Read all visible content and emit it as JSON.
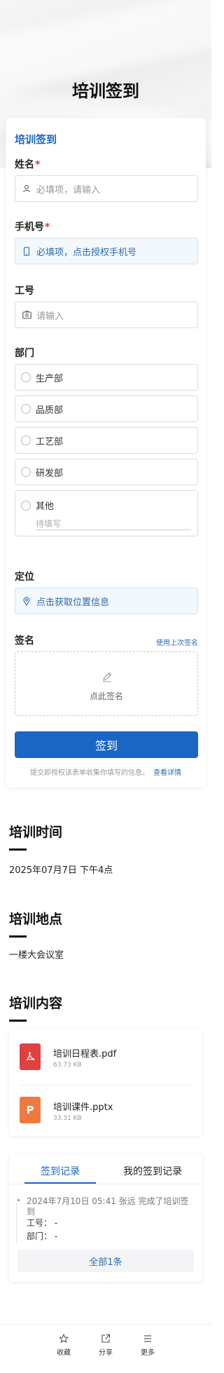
{
  "page": {
    "title": "培训签到"
  },
  "form": {
    "title": "培训签到",
    "name": {
      "label": "姓名",
      "required_mark": "*",
      "placeholder": "必填项，请输入"
    },
    "phone": {
      "label": "手机号",
      "required_mark": "*",
      "placeholder": "必填项，点击授权手机号"
    },
    "employee_id": {
      "label": "工号",
      "placeholder": "请输入"
    },
    "department": {
      "label": "部门",
      "options": [
        "生产部",
        "品质部",
        "工艺部",
        "研发部",
        "其他"
      ],
      "other_placeholder": "待填写"
    },
    "location": {
      "label": "定位",
      "placeholder": "点击获取位置信息"
    },
    "signature": {
      "label": "签名",
      "use_last": "使用上次签名",
      "hint": "点此签名"
    },
    "submit_label": "签到",
    "notice": "提交即授权该表单收集你填写的信息。",
    "notice_link": "查看详情"
  },
  "info": {
    "time": {
      "title": "培训时间",
      "value": "2025年07月7日 下午4点"
    },
    "place": {
      "title": "培训地点",
      "value": "一楼大会议室"
    },
    "content": {
      "title": "培训内容",
      "files": [
        {
          "name": "培训日程表.pdf",
          "size": "63.73 KB",
          "type": "pdf"
        },
        {
          "name": "培训课件.pptx",
          "size": "33.31 KB",
          "type": "ppt"
        }
      ]
    }
  },
  "records": {
    "tabs": [
      "签到记录",
      "我的签到记录"
    ],
    "active_tab": 0,
    "items": [
      {
        "line1": "2024年7月10日 05:41  张远  完成了培训签",
        "line2": "到",
        "employee_id": "工号：  -",
        "department": "部门：  -"
      }
    ],
    "all_label": "全部1条"
  },
  "bottom_nav": [
    {
      "label": "收藏",
      "icon": "star-icon"
    },
    {
      "label": "分享",
      "icon": "share-icon"
    },
    {
      "label": "更多",
      "icon": "menu-icon"
    }
  ],
  "colors": {
    "accent": "#1a66c4",
    "required": "#e0383e",
    "pdf": "#e04040",
    "ppt": "#ee7a3f"
  }
}
